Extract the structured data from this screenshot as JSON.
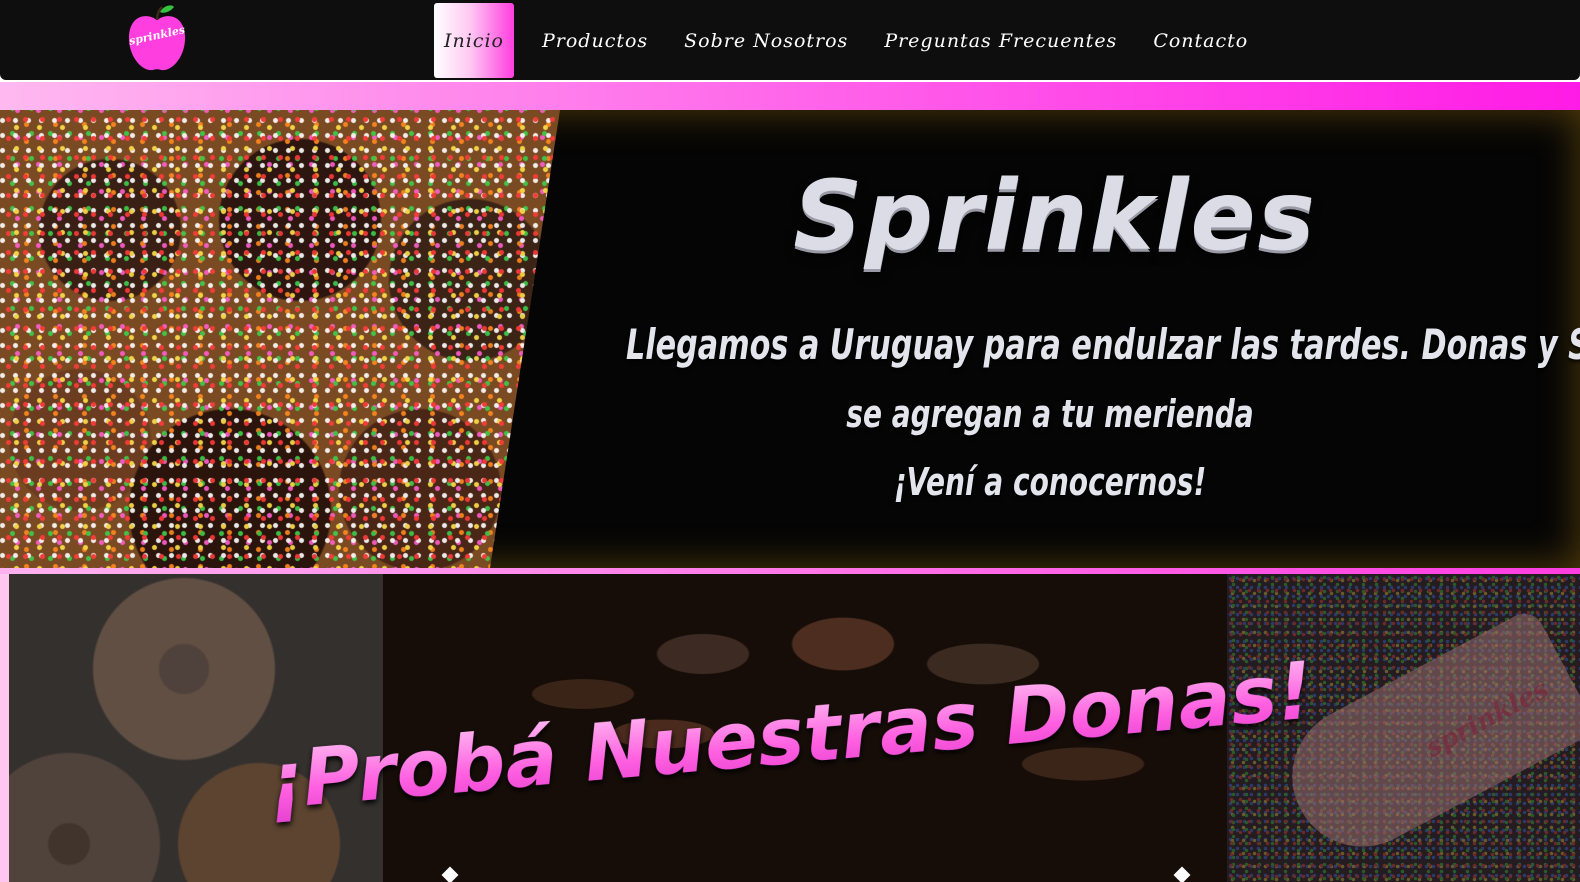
{
  "logo": {
    "text": "sprinkles"
  },
  "nav": {
    "items": [
      {
        "label": "Inicio",
        "active": true
      },
      {
        "label": "Productos",
        "active": false
      },
      {
        "label": "Sobre Nosotros",
        "active": false
      },
      {
        "label": "Preguntas Frecuentes",
        "active": false
      },
      {
        "label": "Contacto",
        "active": false
      }
    ]
  },
  "hero": {
    "title": "Sprinkles",
    "line1": "Llegamos a Uruguay para endulzar las tardes. Donas y Smoothies",
    "line2": "se agregan a tu merienda",
    "line3": "¡Vení a conocernos!"
  },
  "donas": {
    "title": "¡Probá Nuestras Donas!",
    "scoop_text": "sprinkles"
  },
  "colors": {
    "navbar": "#0e0e0e",
    "accent_pink": "#ff3de2",
    "light_pink": "#ffb9f0"
  }
}
